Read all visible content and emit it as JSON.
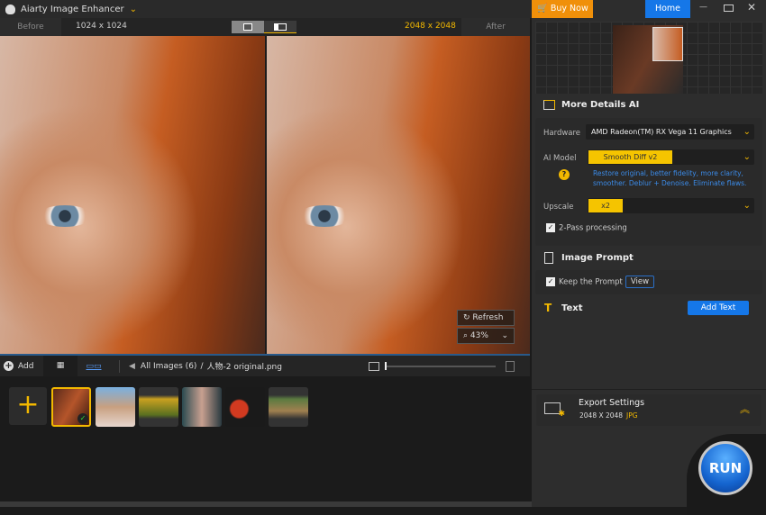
{
  "app": {
    "title": "Aiarty Image Enhancer"
  },
  "compare": {
    "before_label": "Before",
    "before_size": "1024 x 1024",
    "after_size": "2048 x 2048",
    "after_label": "After"
  },
  "overlay": {
    "refresh": "Refresh",
    "zoom": "43%"
  },
  "toolbar": {
    "add": "Add",
    "breadcrumb_all": "All Images (6)",
    "breadcrumb_sep": "/",
    "file": "人物-2 original.png",
    "slider_value": 0.02
  },
  "thumbnails": [
    {
      "name": "redhead"
    },
    {
      "name": "woman"
    },
    {
      "name": "flowers"
    },
    {
      "name": "girl"
    },
    {
      "name": "tomato"
    },
    {
      "name": "tiger"
    }
  ],
  "header": {
    "buy": "Buy Now",
    "home": "Home"
  },
  "details": {
    "title": "More Details AI",
    "hardware_label": "Hardware",
    "hardware": "AMD Radeon(TM) RX Vega 11 Graphics",
    "model_label": "AI Model",
    "model": "Smooth Diff v2",
    "model_desc": "Restore original, better fidelity, more clarity, smoother. Deblur + Denoise. Eliminate flaws.",
    "upscale_label": "Upscale",
    "upscale": "x2",
    "two_pass": "2-Pass processing"
  },
  "prompt": {
    "title": "Image Prompt",
    "keep": "Keep the Prompt",
    "view": "View"
  },
  "text": {
    "title": "Text",
    "add": "Add Text"
  },
  "export": {
    "title": "Export Settings",
    "size": "2048 X 2048",
    "format": "JPG"
  },
  "run": "RUN"
}
